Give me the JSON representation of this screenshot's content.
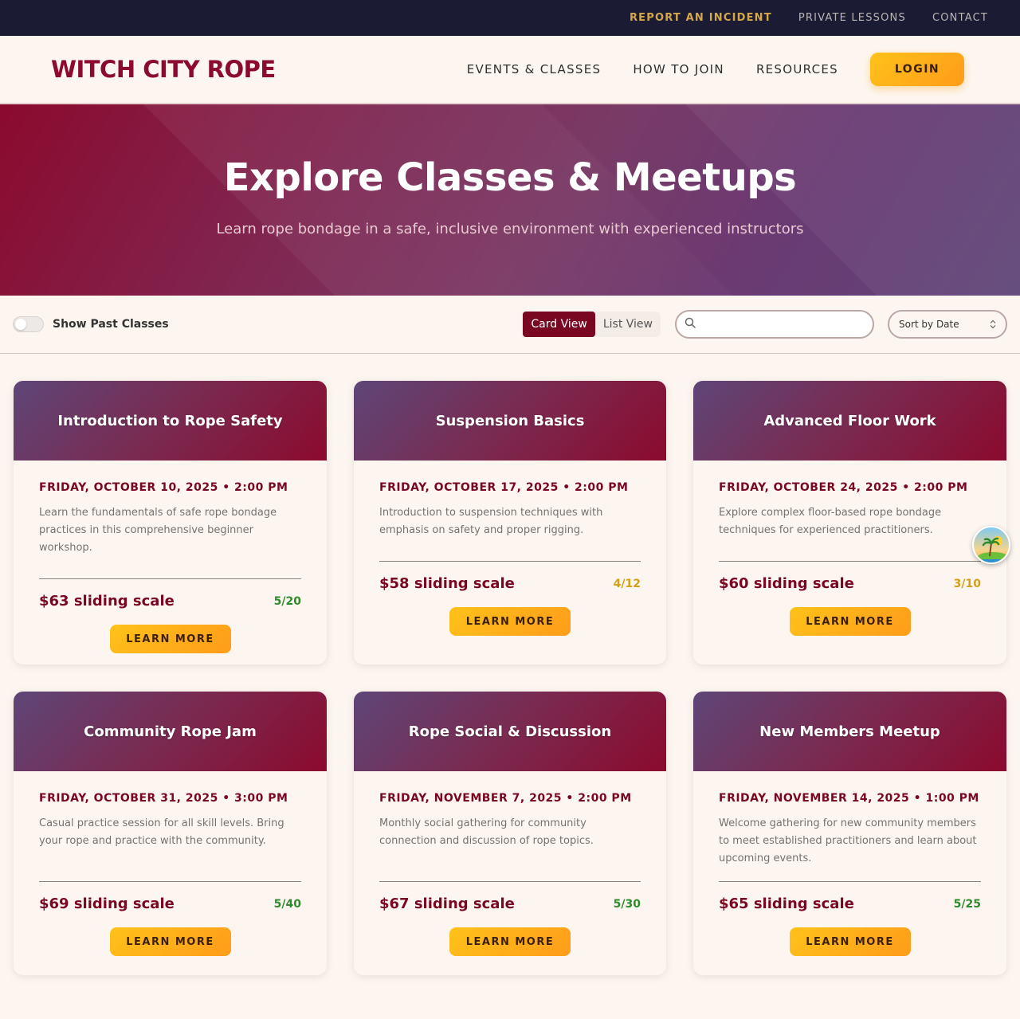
{
  "utility": {
    "report": "REPORT AN INCIDENT",
    "lessons": "PRIVATE LESSONS",
    "contact": "CONTACT"
  },
  "header": {
    "logo": "WITCH CITY ROPE",
    "nav": [
      "EVENTS & CLASSES",
      "HOW TO JOIN",
      "RESOURCES"
    ],
    "login": "LOGIN"
  },
  "hero": {
    "title": "Explore Classes & Meetups",
    "subtitle": "Learn rope bondage in a safe, inclusive environment with experienced instructors"
  },
  "filters": {
    "toggle_label": "Show Past Classes",
    "toggle_on": false,
    "card_view": "Card View",
    "list_view": "List View",
    "active_view": "card",
    "search_value": "",
    "sort_value": "Sort by Date"
  },
  "colors": {
    "brand": "#8b0a2e",
    "accent": "#ffb21a",
    "capacity_ok": "#2e8b2e",
    "capacity_warn": "#d4a019"
  },
  "events": [
    {
      "title": "Introduction to Rope Safety",
      "date": "FRIDAY, OCTOBER 10, 2025 • 2:00 PM",
      "description": "Learn the fundamentals of safe rope bondage practices in this comprehensive beginner workshop.",
      "price": "$63 sliding scale",
      "capacity": "5/20",
      "capacity_status": "green",
      "cta": "LEARN MORE"
    },
    {
      "title": "Suspension Basics",
      "date": "FRIDAY, OCTOBER 17, 2025 • 2:00 PM",
      "description": "Introduction to suspension techniques with emphasis on safety and proper rigging.",
      "price": "$58 sliding scale",
      "capacity": "4/12",
      "capacity_status": "amber",
      "cta": "LEARN MORE"
    },
    {
      "title": "Advanced Floor Work",
      "date": "FRIDAY, OCTOBER 24, 2025 • 2:00 PM",
      "description": "Explore complex floor-based rope bondage techniques for experienced practitioners.",
      "price": "$60 sliding scale",
      "capacity": "3/10",
      "capacity_status": "amber",
      "cta": "LEARN MORE"
    },
    {
      "title": "Community Rope Jam",
      "date": "FRIDAY, OCTOBER 31, 2025 • 3:00 PM",
      "description": "Casual practice session for all skill levels. Bring your rope and practice with the community.",
      "price": "$69 sliding scale",
      "capacity": "5/40",
      "capacity_status": "green",
      "cta": "LEARN MORE"
    },
    {
      "title": "Rope Social & Discussion",
      "date": "FRIDAY, NOVEMBER 7, 2025 • 2:00 PM",
      "description": "Monthly social gathering for community connection and discussion of rope topics.",
      "price": "$67 sliding scale",
      "capacity": "5/30",
      "capacity_status": "green",
      "cta": "LEARN MORE"
    },
    {
      "title": "New Members Meetup",
      "date": "FRIDAY, NOVEMBER 14, 2025 • 1:00 PM",
      "description": "Welcome gathering for new community members to meet established practitioners and learn about upcoming events.",
      "price": "$65 sliding scale",
      "capacity": "5/25",
      "capacity_status": "green",
      "cta": "LEARN MORE"
    }
  ]
}
